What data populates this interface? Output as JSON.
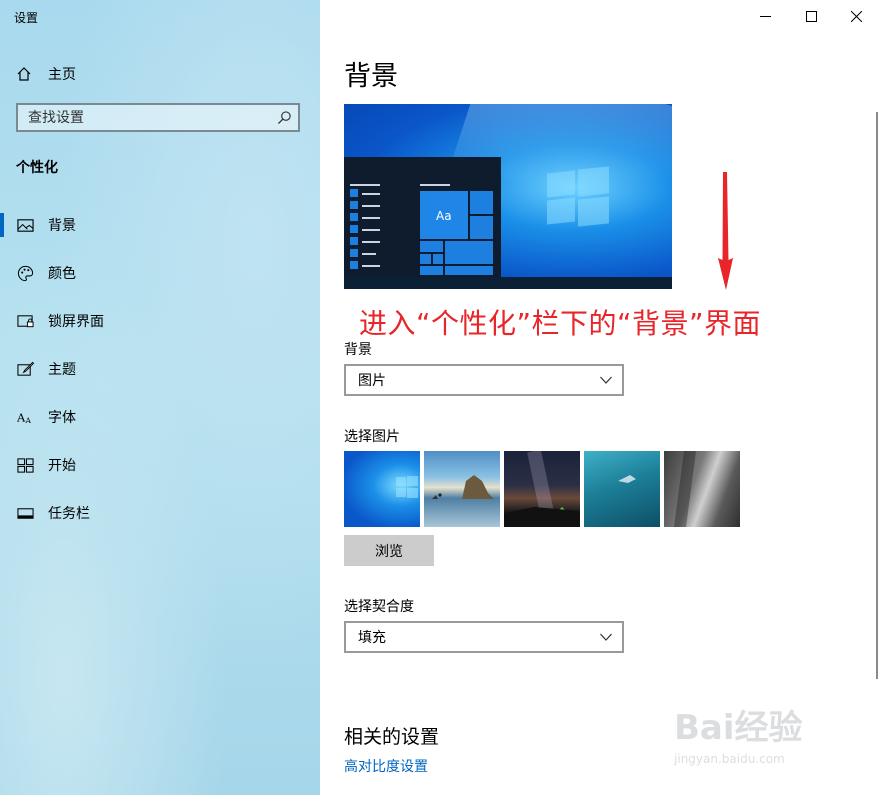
{
  "window": {
    "title": "设置"
  },
  "sidebar": {
    "home_label": "主页",
    "search_placeholder": "查找设置",
    "section_title": "个性化",
    "items": [
      {
        "label": "背景",
        "icon": "image-icon",
        "active": true
      },
      {
        "label": "颜色",
        "icon": "palette-icon"
      },
      {
        "label": "锁屏界面",
        "icon": "lock-screen-icon"
      },
      {
        "label": "主题",
        "icon": "theme-brush-icon"
      },
      {
        "label": "字体",
        "icon": "font-icon"
      },
      {
        "label": "开始",
        "icon": "start-grid-icon"
      },
      {
        "label": "任务栏",
        "icon": "taskbar-icon"
      }
    ]
  },
  "main": {
    "page_title": "背景",
    "preview_tile_text": "Aa",
    "annotation": "进入“个性化”栏下的“背景”界面",
    "background_label": "背景",
    "background_value": "图片",
    "choose_picture_label": "选择图片",
    "browse_label": "浏览",
    "fit_label": "选择契合度",
    "fit_value": "填充",
    "related_title": "相关的设置",
    "related_link": "高对比度设置"
  },
  "watermark": {
    "brand": "Bai经验",
    "url": "jingyan.baidu.com"
  },
  "colors": {
    "accent": "#0067c0",
    "annotation": "#e8262a"
  }
}
